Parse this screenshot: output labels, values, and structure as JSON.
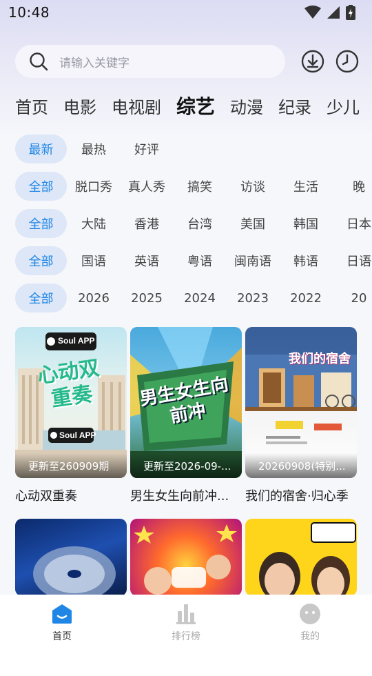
{
  "status": {
    "time": "10:48"
  },
  "search": {
    "placeholder": "请输入关键字"
  },
  "categories": [
    "首页",
    "电影",
    "电视剧",
    "综艺",
    "动漫",
    "纪录",
    "少儿"
  ],
  "categories_active_index": 3,
  "filters": {
    "sort": [
      "最新",
      "最热",
      "好评"
    ],
    "type": [
      "全部",
      "脱口秀",
      "真人秀",
      "搞笑",
      "访谈",
      "生活",
      "晚"
    ],
    "region": [
      "全部",
      "大陆",
      "香港",
      "台湾",
      "美国",
      "韩国",
      "日本"
    ],
    "language": [
      "全部",
      "国语",
      "英语",
      "粤语",
      "闽南语",
      "韩语",
      "日语"
    ],
    "year": [
      "全部",
      "2026",
      "2025",
      "2024",
      "2023",
      "2022",
      "20"
    ]
  },
  "cards": [
    {
      "label": "更新至260909期",
      "title": "心动双重奏",
      "poster_text": "心动双重奏",
      "brand": "Soul APP"
    },
    {
      "label": "更新至2026-09-...",
      "title": "男生女生向前冲...",
      "poster_text": "男生女生向前冲"
    },
    {
      "label": "20260908(特别...",
      "title": "我们的宿舍·归心季",
      "poster_text": "我们的宿舍"
    },
    {
      "label": "",
      "title": "",
      "poster_text": ""
    },
    {
      "label": "",
      "title": "",
      "poster_text": ""
    },
    {
      "label": "",
      "title": "",
      "poster_text": ""
    }
  ],
  "nav": [
    {
      "label": "首页",
      "icon": "home-icon"
    },
    {
      "label": "排行榜",
      "icon": "chart-icon"
    },
    {
      "label": "我的",
      "icon": "profile-icon"
    }
  ],
  "colors": {
    "accent": "#1f86e6",
    "chip_bg": "#dde7f7"
  }
}
